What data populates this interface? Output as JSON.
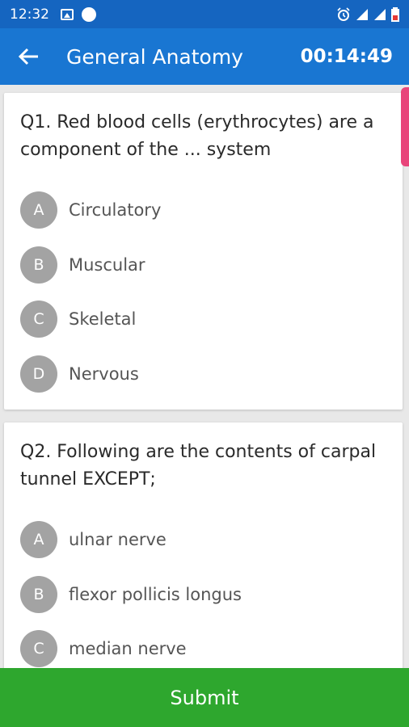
{
  "status_bar": {
    "time": "12:32"
  },
  "app_bar": {
    "title": "General Anatomy",
    "timer": "00:14:49"
  },
  "questions": [
    {
      "text": "Q1. Red blood cells (erythrocytes) are a component of the ... system",
      "options": [
        {
          "letter": "A",
          "text": "Circulatory"
        },
        {
          "letter": "B",
          "text": "Muscular"
        },
        {
          "letter": "C",
          "text": "Skeletal"
        },
        {
          "letter": "D",
          "text": "Nervous"
        }
      ]
    },
    {
      "text": "Q2. Following are the contents of carpal tunnel EXCEPT;",
      "options": [
        {
          "letter": "A",
          "text": "ulnar nerve"
        },
        {
          "letter": "B",
          "text": "flexor pollicis longus"
        },
        {
          "letter": "C",
          "text": "median nerve"
        }
      ]
    }
  ],
  "submit_label": "Submit",
  "colors": {
    "status_bar": "#1565c0",
    "app_bar": "#1976d2",
    "submit": "#2ea72e",
    "option_badge": "#a3a3a3",
    "scroll_indicator": "#e8457a"
  }
}
